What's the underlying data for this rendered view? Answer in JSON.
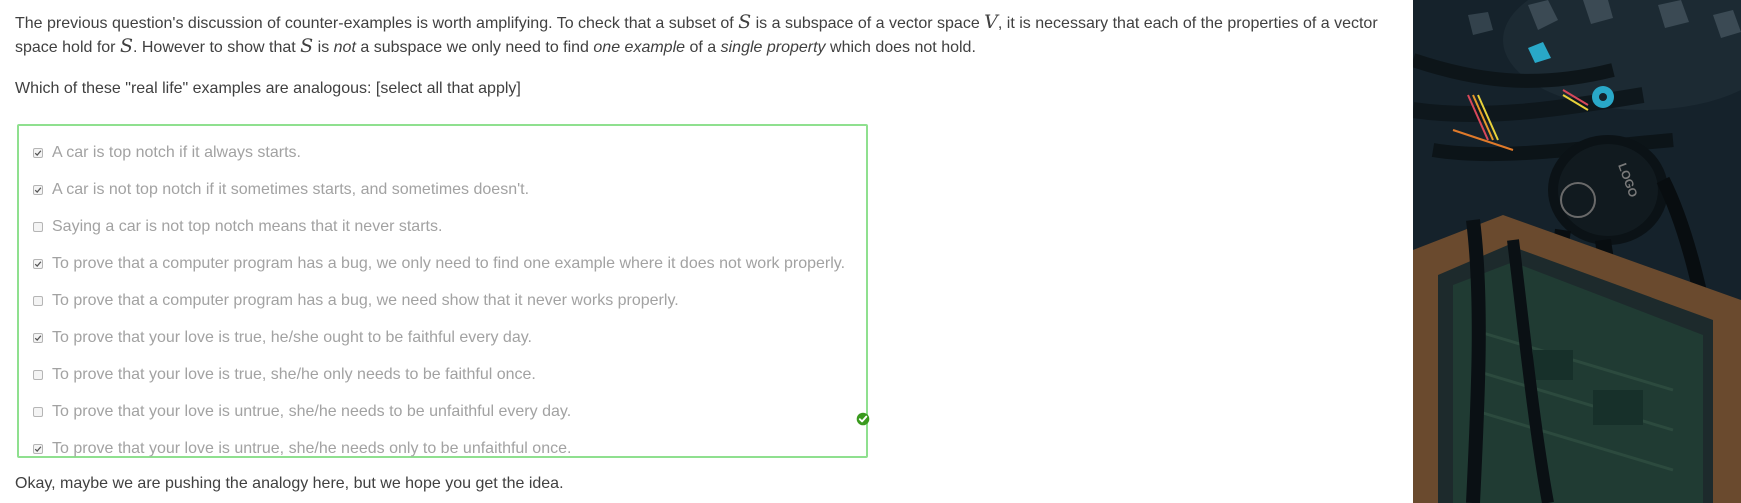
{
  "question": {
    "p1_part1": "The previous question's discussion of counter-examples is worth amplifying. To check that a subset of ",
    "p1_S1": "S",
    "p1_part2": " is a subspace of a vector space ",
    "p1_V": "V",
    "p1_part3": ", it is necessary that each of the properties of a vector",
    "p1_line2_part1": "space hold for ",
    "p1_S2": "S",
    "p1_line2_part2": ". However to show that ",
    "p1_S3": "S",
    "p1_line2_part3": " is ",
    "p1_not": "not",
    "p1_line2_part4": " a subspace we only need to find ",
    "p1_one_example": "one example",
    "p1_line2_part5": " of a ",
    "p1_single_property": "single property",
    "p1_line2_part6": " which does not hold.",
    "prompt": "Which of these \"real life\" examples are analogous: [select all that apply]",
    "closing": "Okay, maybe we are pushing the analogy here, but we hope you get the idea."
  },
  "options": [
    {
      "label": "A car is top notch if it always starts.",
      "checked": true
    },
    {
      "label": "A car is not top notch if it sometimes starts, and sometimes doesn't.",
      "checked": true
    },
    {
      "label": "Saying a car is not top notch means that it never starts.",
      "checked": false
    },
    {
      "label": "To prove that a computer program has a bug, we only need to find one example where it does not work properly.",
      "checked": true
    },
    {
      "label": "To prove that a computer program has a bug, we need show that it never works properly.",
      "checked": false
    },
    {
      "label": "To prove that your love is true, he/she ought to be faithful every day.",
      "checked": true
    },
    {
      "label": "To prove that your love is true, she/he only needs to be faithful once.",
      "checked": false
    },
    {
      "label": "To prove that your love is untrue, she/he needs to be unfaithful every day.",
      "checked": false
    },
    {
      "label": "To prove that your love is untrue, she/he needs only to be unfaithful once.",
      "checked": true
    }
  ],
  "status": {
    "icon": "check-circle-icon",
    "color": "#3a9a1e"
  },
  "colors": {
    "box_border": "#8fe08f",
    "option_text": "#a2a2a2",
    "body_text": "#404040"
  }
}
